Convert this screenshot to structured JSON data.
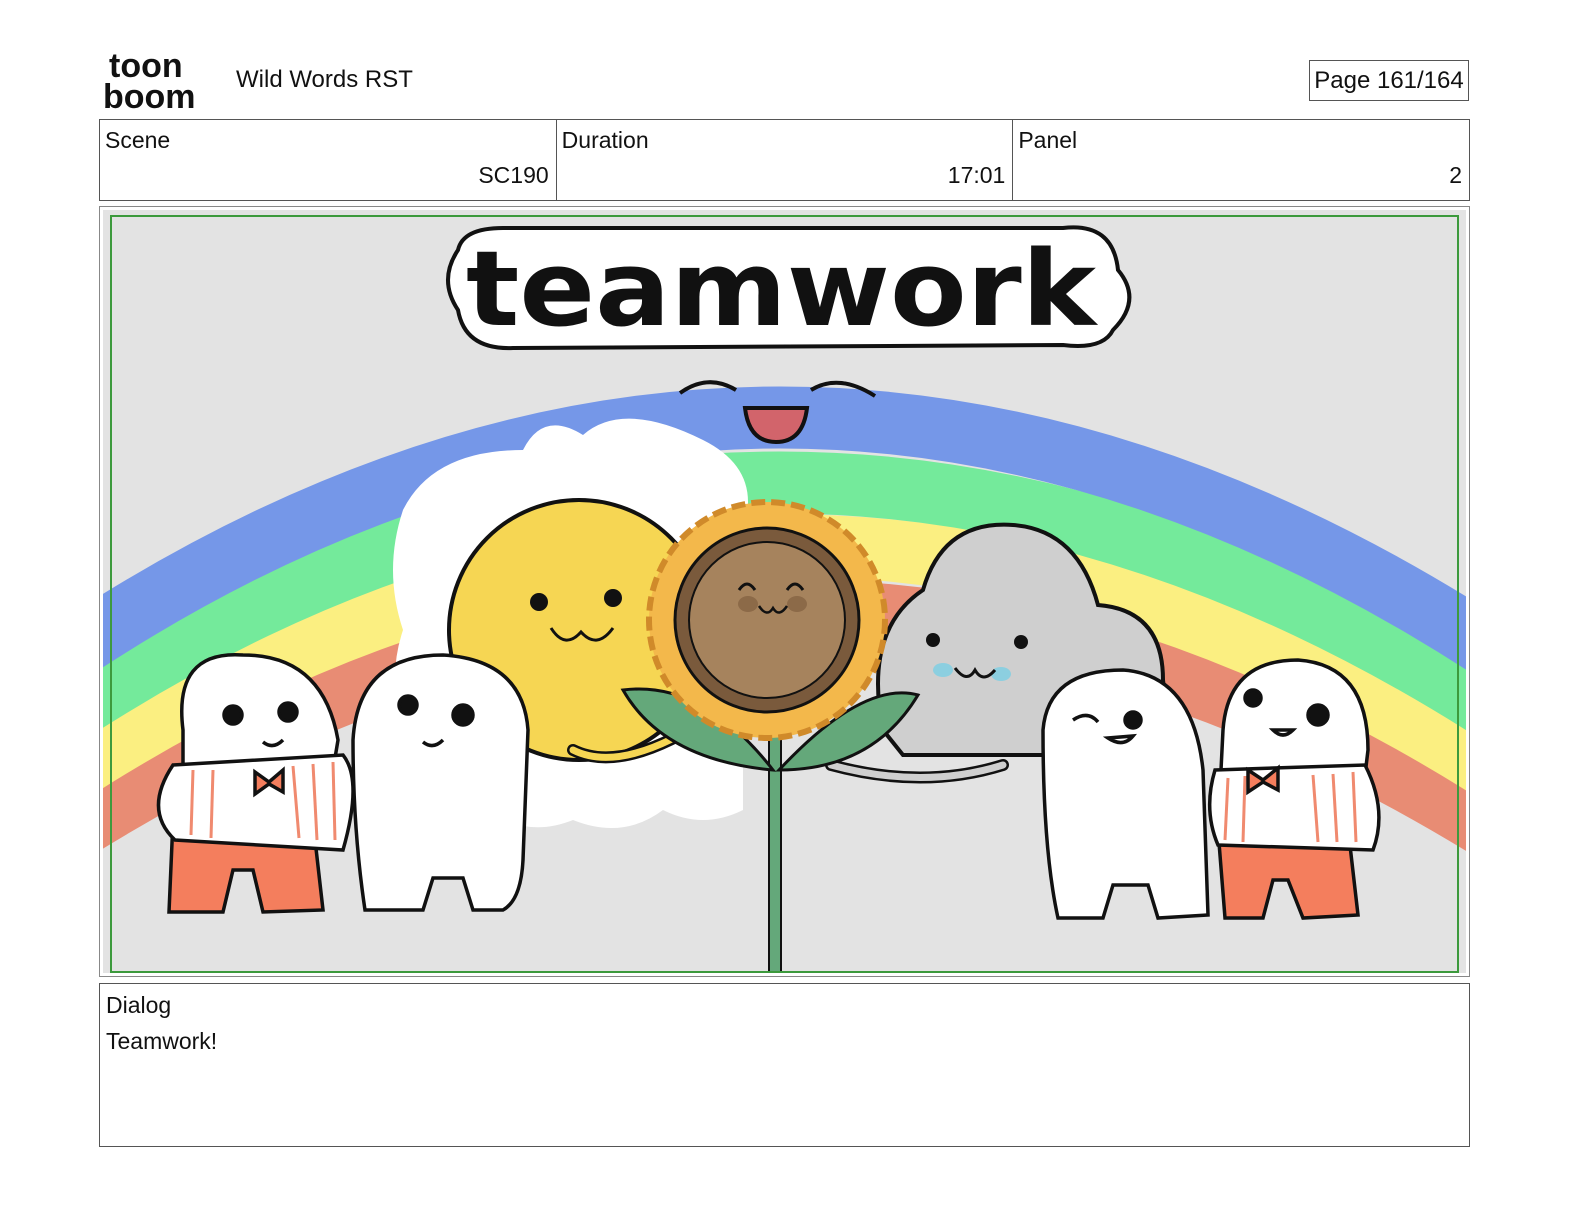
{
  "header": {
    "logo": {
      "line1": "toon",
      "line2": "boom",
      "icon": "toon-boom-logo"
    },
    "project_title": "Wild Words RST",
    "page_label": "Page 161/164"
  },
  "meta": {
    "scene": {
      "label": "Scene",
      "value": "SC190"
    },
    "duration": {
      "label": "Duration",
      "value": "17:01"
    },
    "panel": {
      "label": "Panel",
      "value": "2"
    }
  },
  "panel_image": {
    "title_text": "teamwork",
    "colors": {
      "background": "#e3e3e3",
      "rainbow_blue": "#7597e8",
      "rainbow_green": "#74ea9b",
      "rainbow_yellow": "#fbef81",
      "rainbow_red": "#e88c74",
      "sun": "#f6d653",
      "sunflower_petals": "#f3b84b",
      "sunflower_center": "#a6835d",
      "cloud": "#cfcfcf",
      "leaf": "#64a87a",
      "safe_frame": "#3d9a3d",
      "shirt_stripes": "#f08a6f",
      "pants": "#f47e5d"
    }
  },
  "dialog": {
    "label": "Dialog",
    "text": "Teamwork!"
  }
}
